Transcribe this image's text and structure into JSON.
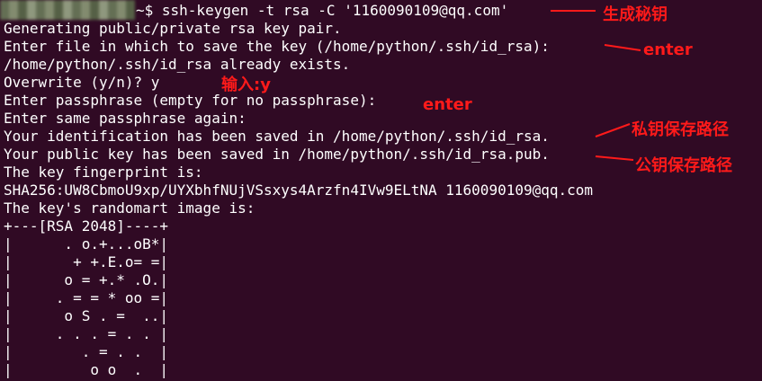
{
  "terminal": {
    "lines": [
      "~$ ssh-keygen -t rsa -C '1160090109@qq.com'",
      "Generating public/private rsa key pair.",
      "Enter file in which to save the key (/home/python/.ssh/id_rsa):",
      "/home/python/.ssh/id_rsa already exists.",
      "Overwrite (y/n)? y",
      "Enter passphrase (empty for no passphrase):",
      "Enter same passphrase again:",
      "Your identification has been saved in /home/python/.ssh/id_rsa.",
      "Your public key has been saved in /home/python/.ssh/id_rsa.pub.",
      "The key fingerprint is:",
      "SHA256:UW8CbmoU9xp/UYXbhfNUjVSsxys4Arzfn4IVw9ELtNA 1160090109@qq.com",
      "The key's randomart image is:",
      "+---[RSA 2048]----+",
      "|      . o.+...oB*|",
      "|       + +.E.o= =|",
      "|      o = +.* .O.|",
      "|     . = = * oo =|",
      "|      o S . =  ..|",
      "|     . . . = . . |",
      "|        . = . .  |",
      "|         o o  .  |"
    ]
  },
  "annotations": {
    "generate_key": "生成秘钥",
    "enter_1": "enter",
    "input_y": "输入:y",
    "enter_2": "enter",
    "private_key_path": "私钥保存路径",
    "public_key_path": "公钥保存路径"
  },
  "colors": {
    "background": "#300a24",
    "text": "#ffffff",
    "annotation": "#ff1a1a"
  }
}
